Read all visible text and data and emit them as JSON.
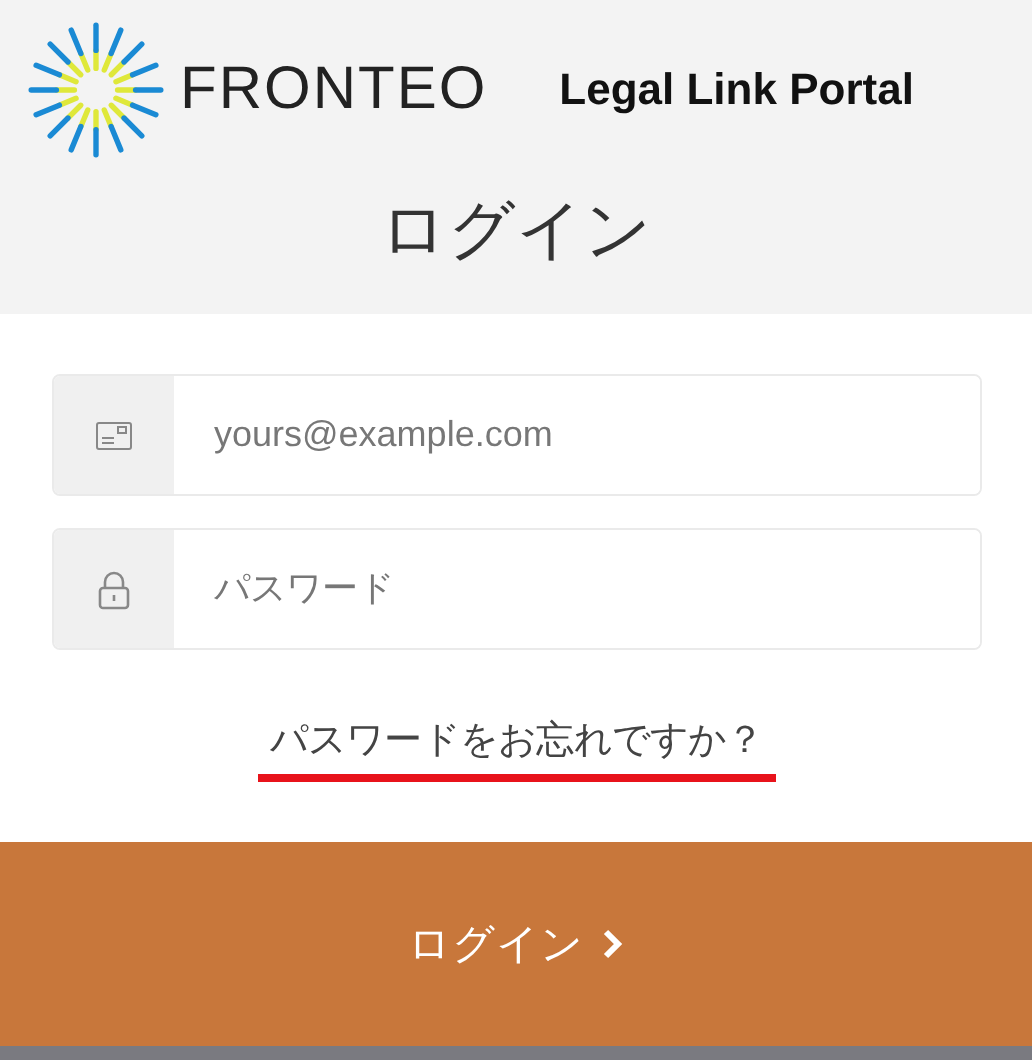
{
  "header": {
    "brand": "FRONTEO",
    "product": "Legal Link Portal",
    "title": "ログイン"
  },
  "fields": [
    {
      "kind": "email",
      "placeholder": "yours@example.com"
    },
    {
      "kind": "password",
      "placeholder": "パスワード"
    }
  ],
  "forgot_link": "パスワードをお忘れですか？",
  "login_button": "ログイン"
}
